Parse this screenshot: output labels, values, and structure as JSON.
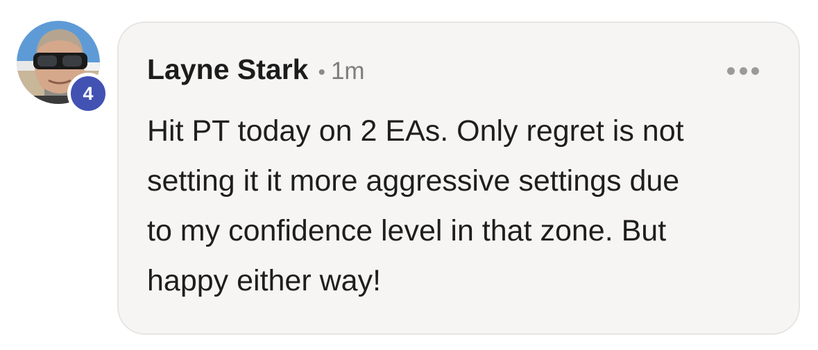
{
  "comment": {
    "author": "Layne Stark",
    "separator": "•",
    "timestamp": "1m",
    "level_badge": "4",
    "body_lines": [
      "Hit PT today on 2 EAs. Only regret is not",
      "setting it it more aggressive settings due",
      "to my confidence level in that zone. But",
      "happy either way!"
    ],
    "more_icon": "more-horizontal-icon",
    "avatar_icon": "user-avatar-photo"
  },
  "colors": {
    "badge": "#4252b3",
    "bubble_bg": "#f6f5f4",
    "bubble_border": "#e6e5e3",
    "text": "#1c1c1c",
    "muted": "#7d7d7d"
  }
}
